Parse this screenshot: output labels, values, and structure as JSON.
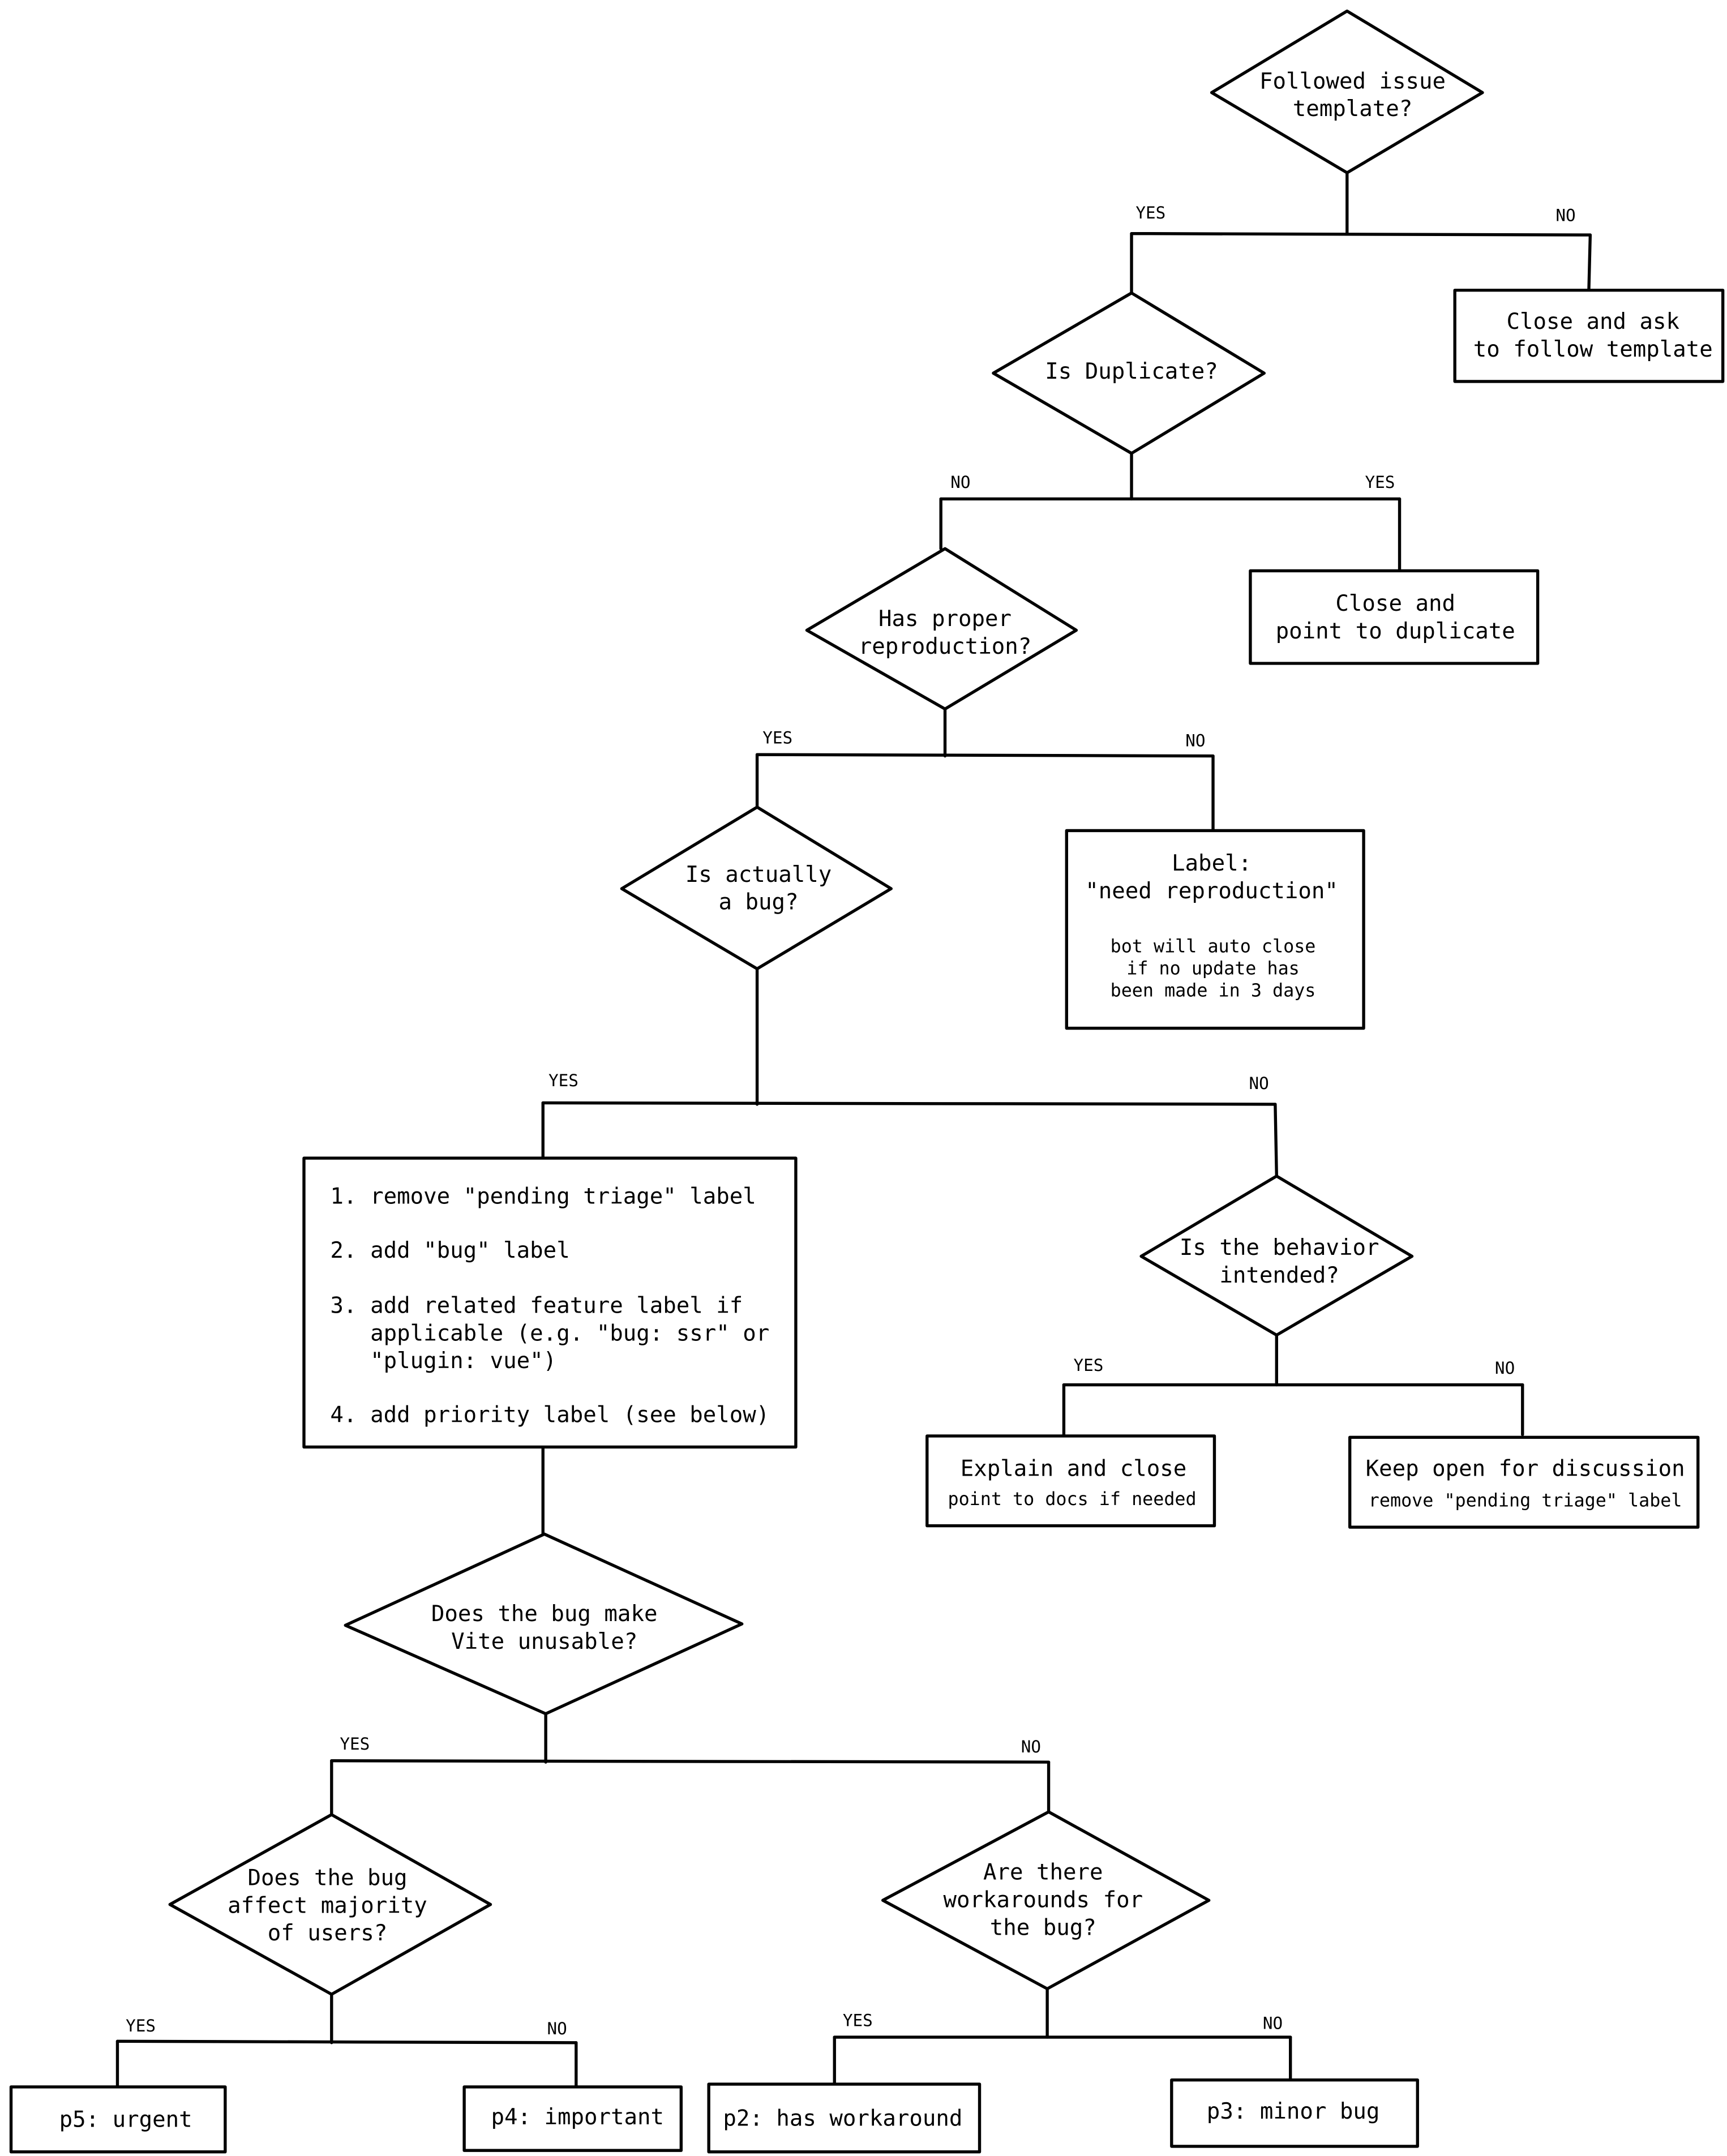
{
  "diagram": {
    "branch_labels": {
      "yes": "YES",
      "no": "NO"
    },
    "nodes": {
      "followed_template": {
        "type": "decision",
        "lines": [
          "Followed issue",
          "template?"
        ]
      },
      "close_ask_template": {
        "type": "action",
        "lines": [
          "Close and ask",
          "to follow template"
        ]
      },
      "is_duplicate": {
        "type": "decision",
        "lines": [
          "Is Duplicate?"
        ]
      },
      "close_duplicate": {
        "type": "action",
        "lines": [
          "Close and",
          "point to duplicate"
        ]
      },
      "has_reproduction": {
        "type": "decision",
        "lines": [
          "Has proper",
          "reproduction?"
        ]
      },
      "need_reproduction": {
        "type": "action",
        "lines": [
          "Label:",
          "\"need reproduction\""
        ],
        "note_lines": [
          "bot will auto close",
          "if no update has",
          "been made in 3 days"
        ]
      },
      "is_bug": {
        "type": "decision",
        "lines": [
          "Is actually",
          "a bug?"
        ]
      },
      "bug_steps": {
        "type": "action",
        "steps": [
          {
            "num": "1.",
            "lines": [
              "remove \"pending triage\" label"
            ]
          },
          {
            "num": "2.",
            "lines": [
              "add \"bug\" label"
            ]
          },
          {
            "num": "3.",
            "lines": [
              "add related feature label if",
              "applicable (e.g. \"bug: ssr\" or",
              "\"plugin: vue\")"
            ]
          },
          {
            "num": "4.",
            "lines": [
              "add priority label (see below)"
            ]
          }
        ]
      },
      "behavior_intended": {
        "type": "decision",
        "lines": [
          "Is the behavior",
          "intended?"
        ]
      },
      "explain_close": {
        "type": "action",
        "lines": [
          "Explain and close"
        ],
        "note_lines": [
          "point to docs if needed"
        ]
      },
      "keep_open": {
        "type": "action",
        "lines": [
          "Keep open for discussion"
        ],
        "note_lines": [
          "remove \"pending triage\" label"
        ]
      },
      "vite_unusable": {
        "type": "decision",
        "lines": [
          "Does the bug make",
          "Vite unusable?"
        ]
      },
      "affect_majority": {
        "type": "decision",
        "lines": [
          "Does the bug",
          "affect majority",
          "of users?"
        ]
      },
      "workarounds": {
        "type": "decision",
        "lines": [
          "Are there",
          "workarounds for",
          "the bug?"
        ]
      },
      "p5": {
        "type": "action",
        "lines": [
          "p5: urgent"
        ]
      },
      "p4": {
        "type": "action",
        "lines": [
          "p4: important"
        ]
      },
      "p2": {
        "type": "action",
        "lines": [
          "p2: has workaround"
        ]
      },
      "p3": {
        "type": "action",
        "lines": [
          "p3: minor bug"
        ]
      }
    }
  }
}
